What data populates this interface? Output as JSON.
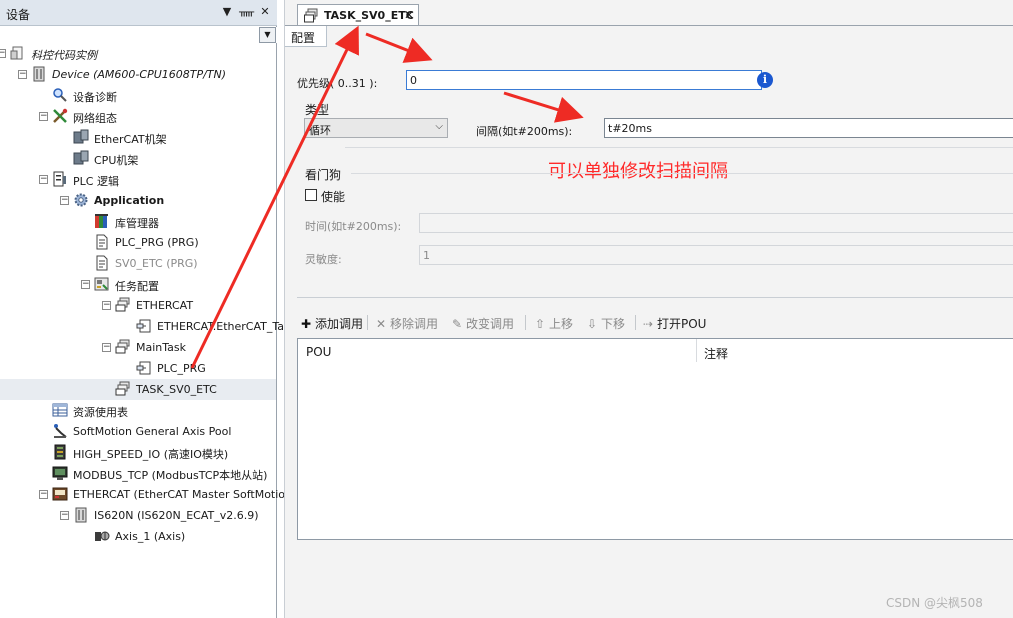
{
  "device_panel": {
    "title": "设备",
    "controls": {
      "dropdown": "▼",
      "pin": "ᚅ",
      "close": "✕"
    },
    "combo_arrow": "▼"
  },
  "tree": [
    {
      "label": "科控代码实例",
      "level": 0,
      "expander": "−",
      "icon": "project-icon",
      "style": "italic"
    },
    {
      "label": "Device (AM600-CPU1608TP/TN)",
      "level": 1,
      "expander": "−",
      "icon": "device-icon",
      "style": "italic"
    },
    {
      "label": "设备诊断",
      "level": 2,
      "expander": "",
      "icon": "magnifier-icon",
      "style": ""
    },
    {
      "label": "网络组态",
      "level": 2,
      "expander": "−",
      "icon": "network-tools-icon",
      "style": ""
    },
    {
      "label": "EtherCAT机架",
      "level": 3,
      "expander": "",
      "icon": "rack-icon",
      "style": ""
    },
    {
      "label": "CPU机架",
      "level": 3,
      "expander": "",
      "icon": "rack-icon",
      "style": ""
    },
    {
      "label": "PLC 逻辑",
      "level": 2,
      "expander": "−",
      "icon": "plc-logic-icon",
      "style": ""
    },
    {
      "label": "Application",
      "level": 3,
      "expander": "−",
      "icon": "application-gear-icon",
      "style": "bold"
    },
    {
      "label": "库管理器",
      "level": 4,
      "expander": "",
      "icon": "library-icon",
      "style": ""
    },
    {
      "label": "PLC_PRG (PRG)",
      "level": 4,
      "expander": "",
      "icon": "pou-document-icon",
      "style": ""
    },
    {
      "label": "SV0_ETC (PRG)",
      "level": 4,
      "expander": "",
      "icon": "pou-document-icon",
      "style": "grey"
    },
    {
      "label": "任务配置",
      "level": 4,
      "expander": "−",
      "icon": "task-config-icon",
      "style": ""
    },
    {
      "label": "ETHERCAT",
      "level": 5,
      "expander": "−",
      "icon": "task-icon",
      "style": ""
    },
    {
      "label": "ETHERCAT.EtherCAT_Task",
      "level": 6,
      "expander": "",
      "icon": "program-call-icon",
      "style": ""
    },
    {
      "label": "MainTask",
      "level": 5,
      "expander": "−",
      "icon": "task-icon",
      "style": ""
    },
    {
      "label": "PLC_PRG",
      "level": 6,
      "expander": "",
      "icon": "program-call-icon",
      "style": ""
    },
    {
      "label": "TASK_SV0_ETC",
      "level": 5,
      "expander": "",
      "icon": "task-icon",
      "style": "",
      "selected": true
    },
    {
      "label": "资源使用表",
      "level": 2,
      "expander": "",
      "icon": "table-icon",
      "style": ""
    },
    {
      "label": "SoftMotion General Axis Pool",
      "level": 2,
      "expander": "",
      "icon": "axis-pool-icon",
      "style": ""
    },
    {
      "label": "HIGH_SPEED_IO (高速IO模块)",
      "level": 2,
      "expander": "",
      "icon": "io-module-icon",
      "style": ""
    },
    {
      "label": "MODBUS_TCP (ModbusTCP本地从站)",
      "level": 2,
      "expander": "",
      "icon": "modbus-icon",
      "style": ""
    },
    {
      "label": "ETHERCAT (EtherCAT Master SoftMotion)",
      "level": 2,
      "expander": "−",
      "icon": "ethercat-master-icon",
      "style": ""
    },
    {
      "label": "IS620N (IS620N_ECAT_v2.6.9)",
      "level": 3,
      "expander": "−",
      "icon": "device-icon",
      "style": ""
    },
    {
      "label": "Axis_1 (Axis)",
      "level": 4,
      "expander": "",
      "icon": "axis-icon",
      "style": ""
    }
  ],
  "editor": {
    "tab_label": "TASK_SV0_ETC",
    "tab_close": "✕",
    "subtab_label": "配置",
    "priority_label": "优先级( 0..31 ):",
    "priority_value": "0",
    "info_icon_glyph": "i",
    "type_label": "类型",
    "type_value": "循环",
    "type_arrow": "⌵",
    "interval_label": "间隔(如t#200ms):",
    "interval_value": "t#20ms",
    "annotation": "可以单独修改扫描间隔",
    "watchdog_label": "看门狗",
    "enable_label": "使能",
    "time_label": "时间(如t#200ms):",
    "time_value": "",
    "sensitivity_label": "灵敏度:",
    "sensitivity_value": "1",
    "toolbar": {
      "add_call": "添加调用",
      "remove_call": "移除调用",
      "change_call": "改变调用",
      "move_up": "上移",
      "move_down": "下移",
      "open_pou": "打开POU"
    },
    "table": {
      "col_pou": "POU",
      "col_comment": "注释"
    }
  },
  "watermark": "CSDN @尖枫508",
  "colors": {
    "annotation": "#ff2a2a",
    "arrow": "#ee2b24",
    "accent": "#1b58d0"
  }
}
